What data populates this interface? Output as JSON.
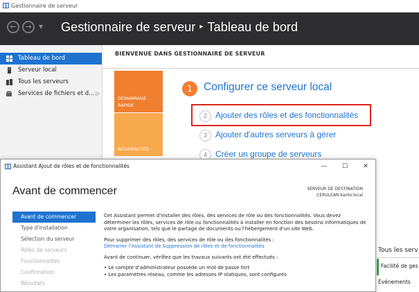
{
  "window": {
    "title": "Gestionnaire de serveur"
  },
  "header": {
    "app": "Gestionnaire de serveur",
    "page": "Tableau de bord"
  },
  "sidebar": {
    "items": [
      {
        "label": "Tableau de bord",
        "icon": "dashboard-icon",
        "active": true
      },
      {
        "label": "Serveur local",
        "icon": "server-icon"
      },
      {
        "label": "Tous les serveurs",
        "icon": "servers-icon"
      },
      {
        "label": "Services de fichiers et d...",
        "icon": "file-services-icon"
      }
    ]
  },
  "welcome": {
    "title": "BIENVENUE DANS GESTIONNAIRE DE SERVEUR",
    "tile_quick_line1": "DÉMARRAGE",
    "tile_quick_line2": "RAPIDE",
    "tile_news": "NOUVEAUTÉS",
    "step1_num": "1",
    "step1": "Configurer ce serveur local",
    "steps": [
      {
        "num": "2",
        "label": "Ajouter des rôles et des fonctionnalités"
      },
      {
        "num": "3",
        "label": "Ajouter d'autres serveurs à gérer"
      },
      {
        "num": "4",
        "label": "Créer un groupe de serveurs"
      }
    ]
  },
  "right_card": {
    "title": "Tous les serv",
    "items": [
      "Facilité de ges",
      "Événements"
    ]
  },
  "dialog": {
    "title": "Assistant Ajout de rôles et de fonctionnalités",
    "heading": "Avant de commencer",
    "destination_label": "SERVEUR DE DESTINATION",
    "destination_value": "CERULEAN.kanto.local",
    "nav": [
      {
        "label": "Avant de commencer",
        "state": "active"
      },
      {
        "label": "Type d'installation",
        "state": "normal"
      },
      {
        "label": "Sélection du serveur",
        "state": "normal"
      },
      {
        "label": "Rôles de serveurs",
        "state": "disabled"
      },
      {
        "label": "Fonctionnalités",
        "state": "disabled"
      },
      {
        "label": "Confirmation",
        "state": "disabled"
      },
      {
        "label": "Résultats",
        "state": "disabled"
      }
    ],
    "para1": "Cet Assistant permet d'installer des rôles, des services de rôle ou des fonctionnalités. Vous devez déterminer les rôles, services de rôle ou fonctionnalités à installer en fonction des besoins informatiques de votre organisation, tels que le partage de documents ou l'hébergement d'un site Web.",
    "para2": "Pour supprimer des rôles, des services de rôle ou des fonctionnalités :",
    "link": "Démarrer l'Assistant de Suppression de rôles et de fonctionnalités",
    "para3": "Avant de continuer, vérifiez que les travaux suivants ont été effectués :",
    "bullets": [
      "Le compte d'administrateur possède un mot de passe fort",
      "Les paramètres réseau, comme les adresses IP statiques, sont configurés"
    ]
  },
  "colors": {
    "header_bg": "#2d2d30",
    "accent_blue": "#1f73cf",
    "quick_start_orange": "#f07f2f",
    "news_orange": "#f7a94e",
    "highlight_red": "#d9261c"
  }
}
